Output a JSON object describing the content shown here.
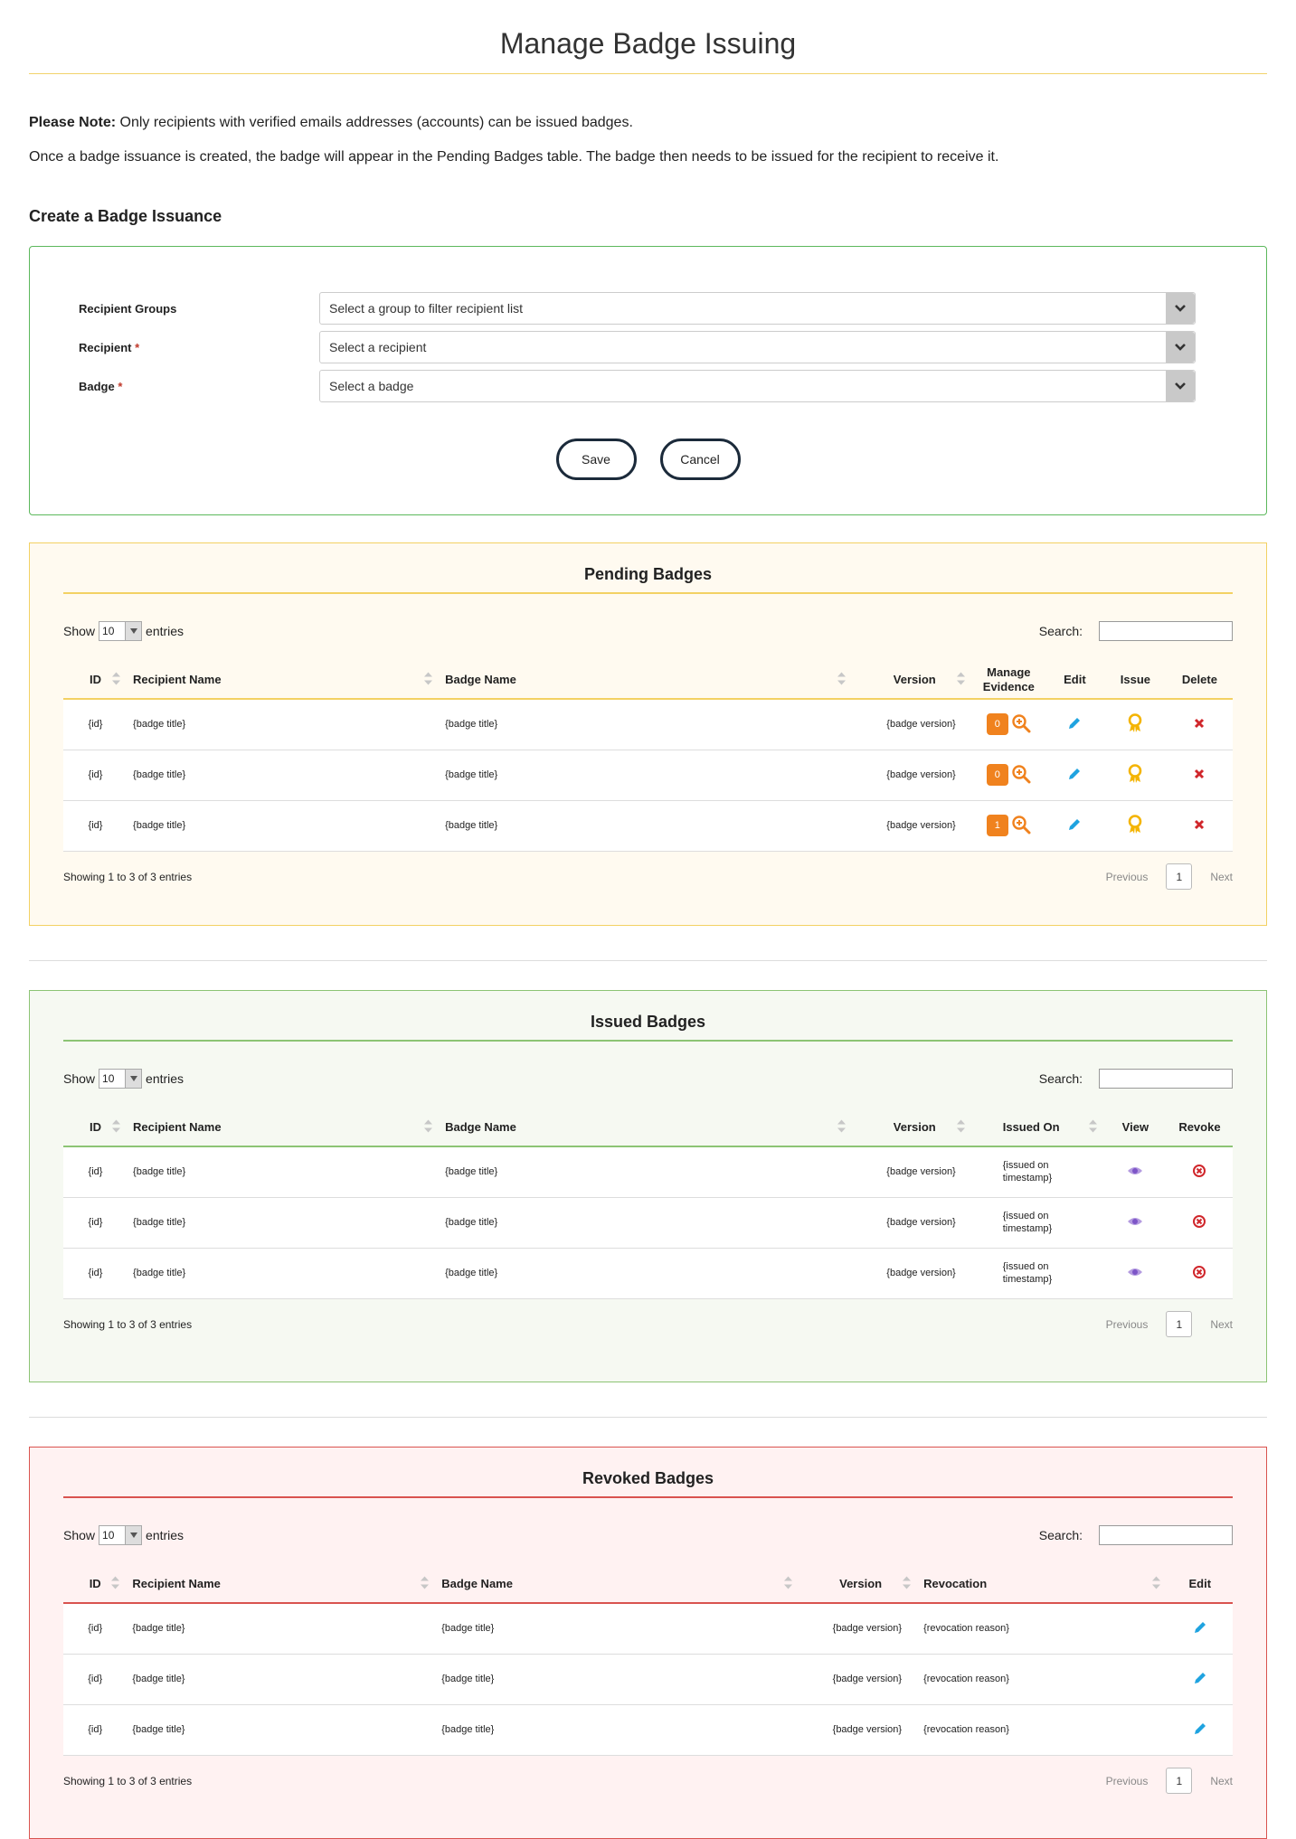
{
  "page": {
    "title": "Manage Badge Issuing",
    "note_bold": "Please Note:",
    "note_text": " Only recipients with verified emails addresses (accounts) can be issued badges.",
    "note2": "Once a badge issuance is created, the badge will appear in the Pending Badges table. The badge then needs to be issued for the recipient to receive it."
  },
  "form": {
    "heading": "Create a Badge Issuance",
    "fields": [
      {
        "label": "Recipient Groups",
        "required": false,
        "placeholder": "Select a group to filter recipient list"
      },
      {
        "label": "Recipient",
        "required": true,
        "placeholder": "Select a recipient"
      },
      {
        "label": "Badge",
        "required": true,
        "placeholder": "Select a badge"
      }
    ],
    "required_mark": "*",
    "save": "Save",
    "cancel": "Cancel"
  },
  "common": {
    "show": "Show",
    "entries": "entries",
    "length": "10",
    "search": "Search:",
    "showing": "Showing 1 to 3 of 3 entries",
    "previous": "Previous",
    "page": "1",
    "next": "Next"
  },
  "pending": {
    "title": "Pending Badges",
    "headers": [
      "ID",
      "Recipient Name",
      "Badge Name",
      "Version",
      "Manage Evidence",
      "Edit",
      "Issue",
      "Delete"
    ],
    "rows": [
      {
        "id": "{id}",
        "recipient": "{badge title}",
        "badge": "{badge title}",
        "version": "{badge version}",
        "evidence": "0"
      },
      {
        "id": "{id}",
        "recipient": "{badge title}",
        "badge": "{badge title}",
        "version": "{badge version}",
        "evidence": "0"
      },
      {
        "id": "{id}",
        "recipient": "{badge title}",
        "badge": "{badge title}",
        "version": "{badge version}",
        "evidence": "1"
      }
    ]
  },
  "issued": {
    "title": "Issued Badges",
    "headers": [
      "ID",
      "Recipient Name",
      "Badge Name",
      "Version",
      "Issued On",
      "View",
      "Revoke"
    ],
    "rows": [
      {
        "id": "{id}",
        "recipient": "{badge title}",
        "badge": "{badge title}",
        "version": "{badge version}",
        "issued_on": "{issued on timestamp}"
      },
      {
        "id": "{id}",
        "recipient": "{badge title}",
        "badge": "{badge title}",
        "version": "{badge version}",
        "issued_on": "{issued on timestamp}"
      },
      {
        "id": "{id}",
        "recipient": "{badge title}",
        "badge": "{badge title}",
        "version": "{badge version}",
        "issued_on": "{issued on timestamp}"
      }
    ]
  },
  "revoked": {
    "title": "Revoked Badges",
    "headers": [
      "ID",
      "Recipient Name",
      "Badge Name",
      "Version",
      "Revocation",
      "Edit"
    ],
    "rows": [
      {
        "id": "{id}",
        "recipient": "{badge title}",
        "badge": "{badge title}",
        "version": "{badge version}",
        "reason": "{revocation reason}"
      },
      {
        "id": "{id}",
        "recipient": "{badge title}",
        "badge": "{badge title}",
        "version": "{badge version}",
        "reason": "{revocation reason}"
      },
      {
        "id": "{id}",
        "recipient": "{badge title}",
        "badge": "{badge title}",
        "version": "{badge version}",
        "reason": "{revocation reason}"
      }
    ]
  },
  "icons": {
    "sort": "sort-icon",
    "zoom": "zoom-in-icon",
    "edit": "pencil-icon",
    "issue": "award-icon",
    "delete": "close-icon",
    "view": "eye-icon",
    "revoke": "revoke-circle-icon",
    "chevron": "chevron-down-icon"
  },
  "colors": {
    "pending_accent": "#f3d163",
    "issued_accent": "#8cc474",
    "revoked_accent": "#d9534f",
    "evidence_badge": "#f0821e",
    "edit_icon": "#1fa3e0",
    "issue_icon": "#f4b400",
    "delete_icon": "#d0262b",
    "view_icon": "#7d55c7"
  }
}
